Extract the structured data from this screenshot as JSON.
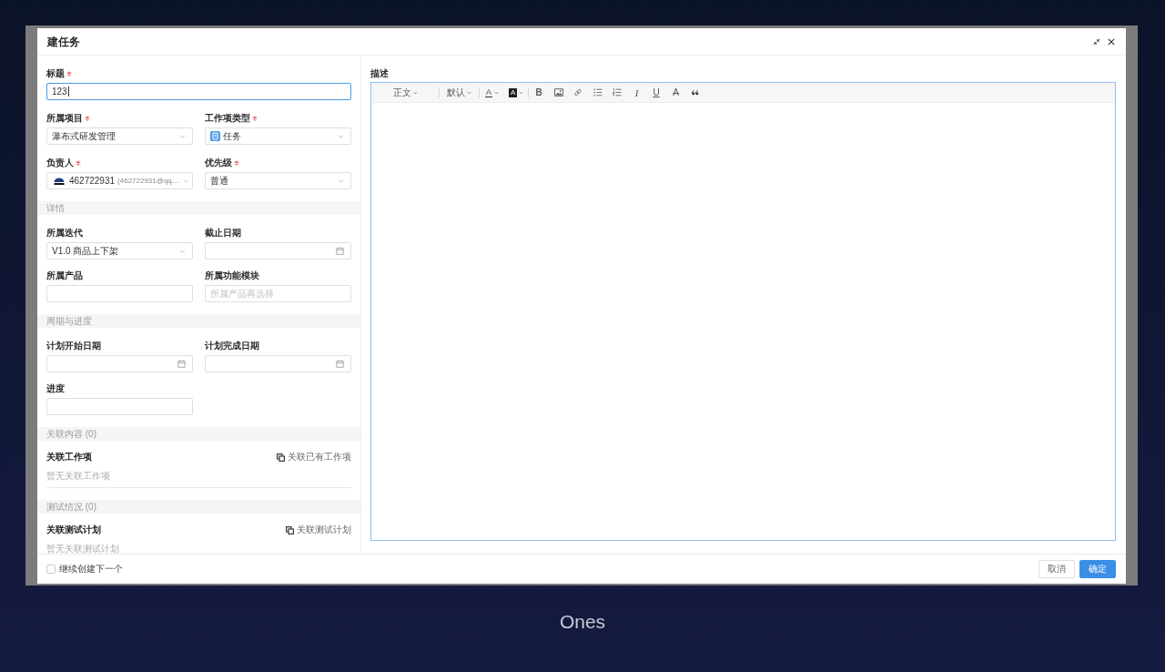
{
  "dialog": {
    "title": "建任务"
  },
  "form": {
    "title_field": {
      "label": "标题",
      "required": true,
      "kind": "text",
      "value": "123",
      "focused": true
    },
    "rows": [
      [
        {
          "label": "所属项目",
          "required": true,
          "kind": "select",
          "value": "瀑布式研发管理",
          "focused": false
        },
        {
          "label": "工作项类型",
          "required": true,
          "kind": "type-select",
          "value": "任务",
          "focused": false
        }
      ],
      [
        {
          "label": "负责人",
          "required": true,
          "kind": "user-select",
          "value": "462722931",
          "detail": "(462722931@qq....",
          "focused": false
        },
        {
          "label": "优先级",
          "required": true,
          "kind": "select",
          "value": "普通",
          "focused": false
        }
      ]
    ],
    "sections": [
      {
        "title": "详情",
        "kind": "fields",
        "rows": [
          [
            {
              "label": "所属迭代",
              "required": false,
              "kind": "select",
              "value": "V1.0 商品上下架",
              "focused": false
            },
            {
              "label": "截止日期",
              "required": false,
              "kind": "date",
              "focused": false
            }
          ],
          [
            {
              "label": "所属产品",
              "required": false,
              "kind": "text",
              "focused": false
            },
            {
              "label": "所属功能模块",
              "required": false,
              "kind": "text",
              "placeholder": "所属产品再选择",
              "focused": false
            }
          ]
        ]
      },
      {
        "title": "周期与进度",
        "kind": "fields",
        "rows": [
          [
            {
              "label": "计划开始日期",
              "required": false,
              "kind": "date",
              "focused": false
            },
            {
              "label": "计划完成日期",
              "required": false,
              "kind": "date",
              "focused": false
            }
          ],
          [
            {
              "label": "进度",
              "required": false,
              "kind": "text",
              "focused": false
            }
          ]
        ]
      },
      {
        "title": "关联内容 (0)",
        "kind": "relation",
        "heading": "关联工作项",
        "action": "关联已有工作项",
        "empty": "暂无关联工作项"
      },
      {
        "title": "测试情况 (0)",
        "kind": "relation",
        "heading": "关联测试计划",
        "action": "关联测试计划",
        "empty": "暂无关联测试计划"
      }
    ]
  },
  "editor": {
    "label": "描述",
    "focused": true,
    "toolbar": [
      {
        "kind": "dropdown",
        "label": "正文"
      },
      {
        "kind": "separator"
      },
      {
        "kind": "dropdown",
        "label": "默认"
      },
      {
        "kind": "separator"
      },
      {
        "kind": "font-color",
        "label": "A"
      },
      {
        "kind": "highlight",
        "label": "A"
      },
      {
        "kind": "separator"
      },
      {
        "kind": "bold",
        "label": "B"
      },
      {
        "kind": "image"
      },
      {
        "kind": "link"
      },
      {
        "kind": "bullets"
      },
      {
        "kind": "numbers"
      },
      {
        "kind": "italic",
        "label": "I"
      },
      {
        "kind": "underline",
        "label": "U"
      },
      {
        "kind": "strike",
        "label": "A"
      },
      {
        "kind": "quote"
      }
    ]
  },
  "footer": {
    "continue": {
      "label": "继续创建下一个",
      "checked": false
    },
    "buttons": [
      {
        "label": "取消",
        "primary": false
      },
      {
        "label": "确定",
        "primary": true
      }
    ]
  },
  "caption": "Ones"
}
